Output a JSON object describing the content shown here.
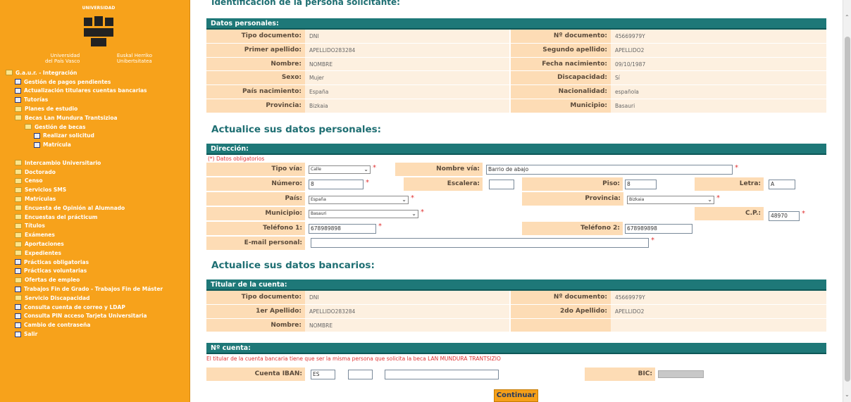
{
  "sidebar": {
    "logo": {
      "top_text": "UNIVERSIDAD",
      "left_text_1": "Universidad",
      "left_text_2": "del País Vasco",
      "right_text_1": "Euskal Herriko",
      "right_text_2": "Unibertsitatea"
    },
    "items": [
      {
        "label": "G.a.u.r. - Integración",
        "level": 0,
        "icon": "folder-open-icon"
      },
      {
        "label": "Gestión de pagos pendientes",
        "level": 1,
        "icon": "document-icon"
      },
      {
        "label": "Actualización titulares cuentas bancarias",
        "level": 1,
        "icon": "document-icon"
      },
      {
        "label": "Tutorías",
        "level": 1,
        "icon": "document-icon"
      },
      {
        "label": "Planes de estudio",
        "level": 1,
        "icon": "folder-icon"
      },
      {
        "label": "Becas Lan Mundura Trantsizioa",
        "level": 1,
        "icon": "folder-icon"
      },
      {
        "label": "Gestión de becas",
        "level": 2,
        "icon": "folder-open-icon"
      },
      {
        "label": "Realizar solicitud",
        "level": 3,
        "icon": "document-icon"
      },
      {
        "label": "Matrícula",
        "level": 3,
        "icon": "document-icon"
      },
      {
        "label": "",
        "level": 1,
        "icon": ""
      },
      {
        "label": "Intercambio Universitario",
        "level": 1,
        "icon": "folder-icon"
      },
      {
        "label": "Doctorado",
        "level": 1,
        "icon": "folder-icon"
      },
      {
        "label": "Censo",
        "level": 1,
        "icon": "folder-icon"
      },
      {
        "label": "Servicios SMS",
        "level": 1,
        "icon": "folder-icon"
      },
      {
        "label": "Matrículas",
        "level": 1,
        "icon": "folder-icon"
      },
      {
        "label": "Encuesta de Opinión al Alumnado",
        "level": 1,
        "icon": "folder-icon"
      },
      {
        "label": "Encuestas del prácticum",
        "level": 1,
        "icon": "folder-icon"
      },
      {
        "label": "Títulos",
        "level": 1,
        "icon": "folder-icon"
      },
      {
        "label": "Exámenes",
        "level": 1,
        "icon": "folder-icon"
      },
      {
        "label": "Aportaciones",
        "level": 1,
        "icon": "folder-icon"
      },
      {
        "label": "Expedientes",
        "level": 1,
        "icon": "folder-icon"
      },
      {
        "label": "Prácticas obligatorias",
        "level": 1,
        "icon": "document-icon"
      },
      {
        "label": "Prácticas voluntarias",
        "level": 1,
        "icon": "document-icon"
      },
      {
        "label": "Ofertas de empleo",
        "level": 1,
        "icon": "folder-icon"
      },
      {
        "label": "Trabajos Fin de Grado - Trabajos Fin de Máster",
        "level": 1,
        "icon": "document-icon"
      },
      {
        "label": "Servicio Discapacidad",
        "level": 1,
        "icon": "folder-icon"
      },
      {
        "label": "Consulta cuenta de correo y LDAP",
        "level": 1,
        "icon": "document-icon"
      },
      {
        "label": "Consulta PIN acceso Tarjeta Universitaria",
        "level": 1,
        "icon": "document-icon"
      },
      {
        "label": "Cambio de contraseña",
        "level": 1,
        "icon": "document-icon"
      },
      {
        "label": "Salir",
        "level": 1,
        "icon": "document-icon"
      }
    ]
  },
  "top_cut_title": "Identificación de la persona solicitante:",
  "personal": {
    "header": "Datos personales:",
    "rows": [
      {
        "l1": "Tipo documento:",
        "v1": "DNI",
        "l2": "Nº documento:",
        "v2": "45669979Y"
      },
      {
        "l1": "Primer apellido:",
        "v1": "APELLIDO283284",
        "l2": "Segundo apellido:",
        "v2": "APELLIDO2"
      },
      {
        "l1": "Nombre:",
        "v1": "NOMBRE",
        "l2": "Fecha nacimiento:",
        "v2": "09/10/1987"
      },
      {
        "l1": "Sexo:",
        "v1": "Mujer",
        "l2": "Discapacidad:",
        "v2": "Sí"
      },
      {
        "l1": "País nacimiento:",
        "v1": "España",
        "l2": "Nacionalidad:",
        "v2": "española"
      },
      {
        "l1": "Provincia:",
        "v1": "Bizkaia",
        "l2": "Municipio:",
        "v2": "Basauri"
      }
    ]
  },
  "update_personal_title": "Actualice sus datos personales:",
  "address": {
    "header": "Dirección:",
    "note": "(*) Datos obligatorios",
    "tipo_via_label": "Tipo vía:",
    "tipo_via_value": "Calle",
    "nombre_via_label": "Nombre vía:",
    "nombre_via_value": "Barrio de abajo",
    "numero_label": "Número:",
    "numero_value": "8",
    "escalera_label": "Escalera:",
    "escalera_value": "",
    "piso_label": "Piso:",
    "piso_value": "8",
    "letra_label": "Letra:",
    "letra_value": "A",
    "pais_label": "País:",
    "pais_value": "España",
    "provincia_label": "Provincia:",
    "provincia_value": "Bizkaia",
    "municipio_label": "Municipio:",
    "municipio_value": "Basauri",
    "cp_label": "C.P.:",
    "cp_value": "48970",
    "tel1_label": "Teléfono 1:",
    "tel1_value": "678989898",
    "tel2_label": "Teléfono 2:",
    "tel2_value": "678989898",
    "email_label": "E-mail personal:",
    "email_value": "",
    "required_mark": "*"
  },
  "update_bank_title": "Actualice sus datos bancarios:",
  "holder": {
    "header": "Titular de la cuenta:",
    "rows": [
      {
        "l1": "Tipo documento:",
        "v1": "DNI",
        "l2": "Nº documento:",
        "v2": "45669979Y"
      },
      {
        "l1": "1er Apellido:",
        "v1": "APELLIDO283284",
        "l2": "2do Apellido:",
        "v2": "APELLIDO2"
      },
      {
        "l1": "Nombre:",
        "v1": "NOMBRE",
        "l2": "",
        "v2": ""
      }
    ]
  },
  "account": {
    "header": "Nº cuenta:",
    "note": "El titular de la cuenta bancaria tiene que ser la misma persona que solicita la beca LAN MUNDURA TRANTSIZIO",
    "iban_label": "Cuenta IBAN:",
    "iban_1": "ES",
    "iban_2": "",
    "iban_3": "",
    "bic_label": "BIC:"
  },
  "continue_label": "Continuar",
  "colors": {
    "sidebar": "#f7a21b",
    "section_header": "#1e7878",
    "label_bg": "#fddcb5",
    "value_bg": "#fdf0e0",
    "title": "#1f6f73",
    "required": "#e03131"
  }
}
